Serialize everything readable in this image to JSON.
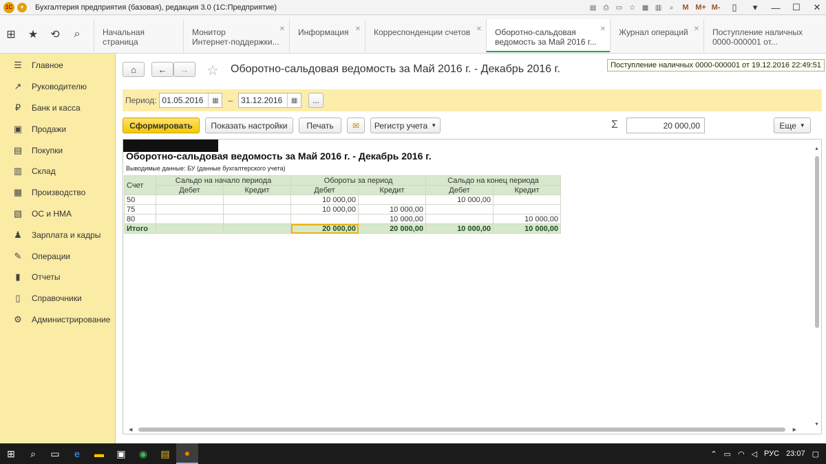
{
  "window": {
    "title": "Бухгалтерия предприятия (базовая), редакция 3.0  (1С:Предприятие)",
    "tools": [
      "save-icon",
      "print-icon",
      "preview-icon",
      "favorite-icon",
      "calendar-icon",
      "calculator-icon",
      "search-icon"
    ],
    "memory_buttons": [
      "M",
      "M+",
      "M-"
    ],
    "controls": [
      "▯",
      "▾",
      "—",
      "☐",
      "✕"
    ]
  },
  "tabs": [
    {
      "line1": "Начальная страница",
      "line2": ""
    },
    {
      "line1": "Монитор",
      "line2": "Интернет-поддержки..."
    },
    {
      "line1": "Информация",
      "line2": ""
    },
    {
      "line1": "Корреспонденции счетов",
      "line2": ""
    },
    {
      "line1": "Оборотно-сальдовая",
      "line2": "ведомость за Май 2016 г..."
    },
    {
      "line1": "Журнал операций",
      "line2": ""
    },
    {
      "line1": "Поступление наличных",
      "line2": "0000-000001 от..."
    }
  ],
  "sidebar": {
    "items": [
      {
        "label": "Главное",
        "icon": "menu-icon"
      },
      {
        "label": "Руководителю",
        "icon": "trend-icon"
      },
      {
        "label": "Банк и касса",
        "icon": "ruble-icon"
      },
      {
        "label": "Продажи",
        "icon": "cart-icon"
      },
      {
        "label": "Покупки",
        "icon": "bag-icon"
      },
      {
        "label": "Склад",
        "icon": "warehouse-icon"
      },
      {
        "label": "Производство",
        "icon": "factory-icon"
      },
      {
        "label": "ОС и НМА",
        "icon": "assets-icon"
      },
      {
        "label": "Зарплата и кадры",
        "icon": "people-icon"
      },
      {
        "label": "Операции",
        "icon": "operations-icon"
      },
      {
        "label": "Отчеты",
        "icon": "reports-icon"
      },
      {
        "label": "Справочники",
        "icon": "books-icon"
      },
      {
        "label": "Администрирование",
        "icon": "gear-icon"
      }
    ]
  },
  "page": {
    "title": "Оборотно-сальдовая ведомость за Май 2016 г. - Декабрь 2016 г.",
    "tooltip": "Поступление наличных 0000-000001 от 19.12.2016 22:49:51",
    "period_label": "Период:",
    "date_from": "01.05.2016",
    "date_to": "31.12.2016",
    "dash": "–",
    "ellipsis": "...",
    "buttons": {
      "generate": "Сформировать",
      "settings": "Показать настройки",
      "print": "Печать",
      "register": "Регистр учета"
    },
    "sum_value": "20 000,00",
    "more": "Еще"
  },
  "report": {
    "title": "Оборотно-сальдовая ведомость за Май 2016 г. - Декабрь 2016 г.",
    "subtitle": "Выводимые данные:  БУ (данные бухгалтерского учета)",
    "headers": {
      "account": "Счет",
      "opening": "Сальдо на начало периода",
      "turnover": "Обороты за период",
      "closing": "Сальдо на конец периода",
      "debit": "Дебет",
      "credit": "Кредит"
    },
    "rows": [
      {
        "account": "50",
        "open_d": "",
        "open_c": "",
        "turn_d": "10 000,00",
        "turn_c": "",
        "close_d": "10 000,00",
        "close_c": ""
      },
      {
        "account": "75",
        "open_d": "",
        "open_c": "",
        "turn_d": "10 000,00",
        "turn_c": "10 000,00",
        "close_d": "",
        "close_c": ""
      },
      {
        "account": "80",
        "open_d": "",
        "open_c": "",
        "turn_d": "",
        "turn_c": "10 000,00",
        "close_d": "",
        "close_c": "10 000,00"
      }
    ],
    "total": {
      "account": "Итого",
      "open_d": "",
      "open_c": "",
      "turn_d": "20 000,00",
      "turn_c": "20 000,00",
      "close_d": "10 000,00",
      "close_c": "10 000,00"
    }
  },
  "taskbar": {
    "lang": "РУС",
    "time": "23:07"
  }
}
